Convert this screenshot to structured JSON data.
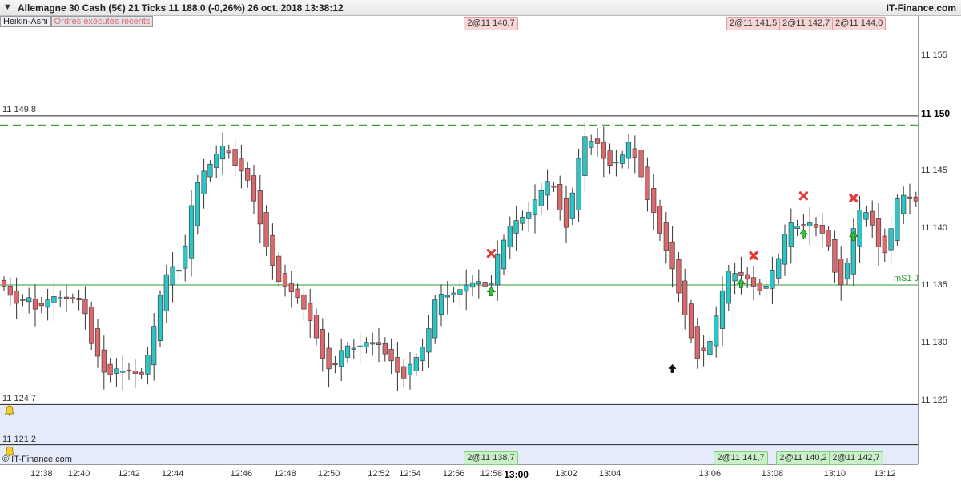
{
  "header": {
    "title": "Allemagne 30 Cash (5€)   21 Ticks   11 188,0 (-0,26%)   26 oct. 2018 13:38:12",
    "brand": "IT-Finance.com"
  },
  "legend": {
    "item1": "Heikin-Ashi",
    "item2": "Ordres exécutés récents"
  },
  "footer": {
    "copyright": "© IT-Finance.com"
  },
  "colors": {
    "up": "#2ec4c6",
    "down": "#d9696b",
    "support": "#2e9a2e",
    "resistance_dash": "#3aa63a",
    "band": "#e6ebfb"
  },
  "hlines": {
    "upper": {
      "label": "11 149,8",
      "value": 11149.8
    },
    "mid": {
      "label": "mS1 J",
      "value": 11135.1
    },
    "low1": {
      "label": "11 124,7",
      "value": 11124.7
    },
    "low2": {
      "label": "11 121,2",
      "value": 11121.2
    },
    "dashed": {
      "value": 11149.0
    }
  },
  "orders": {
    "sells": [
      {
        "label": "2@11 140,7",
        "time_index": 78
      },
      {
        "label": "2@11 141,5",
        "time_index": 120
      },
      {
        "label": "2@11 142,7",
        "time_index": 128
      },
      {
        "label": "2@11 144,0",
        "time_index": 136
      }
    ],
    "buys": [
      {
        "label": "2@11 138,7",
        "time_index": 78
      },
      {
        "label": "2@11 141,7",
        "time_index": 118
      },
      {
        "label": "2@11 140,2",
        "time_index": 128
      },
      {
        "label": "2@11 142,7",
        "time_index": 136
      }
    ]
  },
  "chart_data": {
    "type": "candlestick",
    "style": "Heikin-Ashi",
    "y_ticks": [
      "11 125",
      "11 130",
      "11 135",
      "11 140",
      "11 145",
      "11 150",
      "11 155"
    ],
    "y_tick_values": [
      11125,
      11130,
      11135,
      11140,
      11145,
      11150,
      11155
    ],
    "y_strong": "11 150",
    "ylim": [
      11119.5,
      11158.5
    ],
    "x_ticks": [
      "12:38",
      "12:40",
      "12:42",
      "12:44",
      "12:46",
      "12:48",
      "12:50",
      "12:52",
      "12:54",
      "12:56",
      "12:58",
      "13:00",
      "13:02",
      "13:04",
      "13:06",
      "13:08",
      "13:10",
      "13:12"
    ],
    "x_strong": "13:00",
    "x_tick_index": [
      6,
      12,
      20,
      27,
      38,
      45,
      52,
      60,
      65,
      72,
      78,
      82,
      90,
      97,
      113,
      123,
      133,
      141
    ],
    "x_count": 146,
    "closes": [
      11135.0,
      11134.2,
      11133.5,
      11133.8,
      11134.0,
      11133.0,
      11133.3,
      11133.8,
      11134.1,
      11134.0,
      11134.0,
      11133.9,
      11133.8,
      11132.6,
      11130.0,
      11128.9,
      11127.5,
      11127.3,
      11127.8,
      11127.6,
      11127.6,
      11127.4,
      11127.3,
      11129.0,
      11131.5,
      11134.2,
      11136.0,
      11136.7,
      11136.4,
      11138.5,
      11142.0,
      11144.0,
      11145.0,
      11145.6,
      11146.5,
      11147.2,
      11146.6,
      11145.5,
      11145.0,
      11144.2,
      11142.4,
      11140.4,
      11138.4,
      11136.8,
      11135.4,
      11135.0,
      11134.5,
      11134.0,
      11133.0,
      11132.0,
      11130.5,
      11128.7,
      11127.8,
      11128.2,
      11129.4,
      11129.8,
      11129.6,
      11129.8,
      11130.1,
      11130.1,
      11129.9,
      11129.1,
      11128.5,
      11127.5,
      11127.0,
      11128.2,
      11128.8,
      11129.7,
      11131.3,
      11133.8,
      11134.3,
      11134.2,
      11134.4,
      11134.7,
      11135.1,
      11135.3,
      11135.4,
      11135.0,
      11135.2,
      11137.8,
      11139.0,
      11140.2,
      11140.7,
      11141.0,
      11141.4,
      11142.5,
      11143.3,
      11144.1,
      11143.6,
      11141.6,
      11140.1,
      11143.1,
      11146.1,
      11148.0,
      11147.6,
      11147.4,
      11146.1,
      11145.5,
      11145.8,
      11146.4,
      11147.5,
      11146.2,
      11144.5,
      11142.5,
      11141.4,
      11139.6,
      11138.1,
      11136.5,
      11134.4,
      11132.5,
      11130.5,
      11128.7,
      11129.4,
      11130.2,
      11132.4,
      11134.6,
      11136.3,
      11136.1,
      11135.9,
      11135.6,
      11135.0,
      11134.6,
      11135.0,
      11136.4,
      11137.4,
      11139.5,
      11140.5,
      11140.2,
      11140.2,
      11140.5,
      11140.1,
      11139.6,
      11138.5,
      11136.2,
      11135.1,
      11137.0,
      11140.0,
      11141.6,
      11141.4,
      11140.3,
      11138.4,
      11137.9,
      11140.0,
      11142.6,
      11142.9,
      11142.6,
      11142.4,
      11141.1,
      11140.5,
      11141.5,
      11143.0,
      11144.8
    ]
  }
}
